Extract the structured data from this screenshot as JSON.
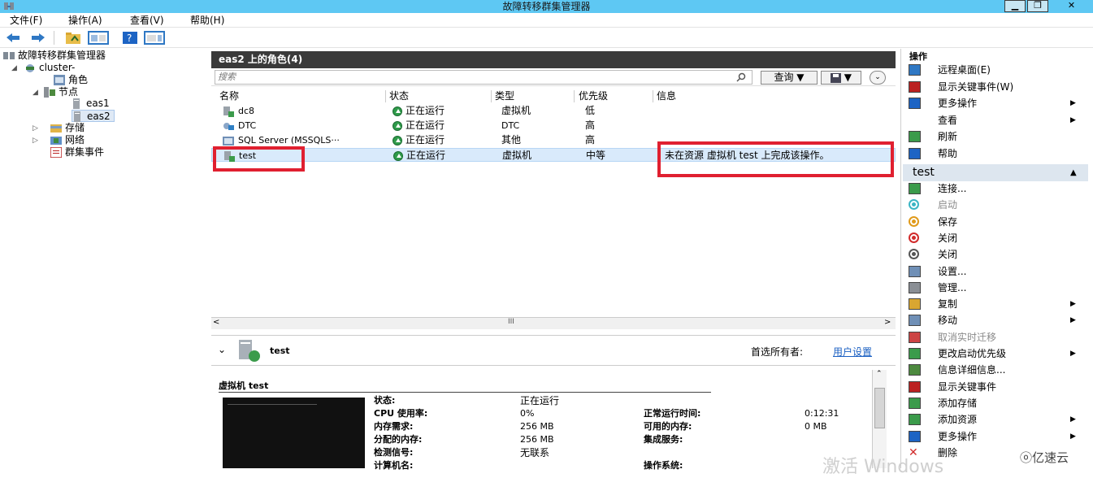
{
  "window": {
    "title": "故障转移群集管理器",
    "controls": {
      "minimize": "▁",
      "maximize": "❐",
      "close": "✕"
    }
  },
  "menu": [
    "文件(F)",
    "操作(A)",
    "查看(V)",
    "帮助(H)"
  ],
  "tree": {
    "root": "故障转移群集管理器",
    "cluster": "cluster-",
    "roles": "角色",
    "nodes": "节点",
    "node1": "eas1",
    "node2": "eas2",
    "storage": "存储",
    "network": "网络",
    "events": "群集事件"
  },
  "center": {
    "header": "eas2 上的角色(4)",
    "search_placeholder": "搜索",
    "query_label": "查询",
    "columns": [
      "名称",
      "状态",
      "类型",
      "优先级",
      "信息"
    ],
    "rows": [
      {
        "name": "dc8",
        "status": "正在运行",
        "type": "虚拟机",
        "priority": "低",
        "info": ""
      },
      {
        "name": "DTC",
        "status": "正在运行",
        "type": "DTC",
        "priority": "高",
        "info": ""
      },
      {
        "name": "SQL Server (MSSQLS···",
        "status": "正在运行",
        "type": "其他",
        "priority": "高",
        "info": ""
      },
      {
        "name": "test",
        "status": "正在运行",
        "type": "虚拟机",
        "priority": "中等",
        "info": "未在资源 虚拟机 test 上完成该操作。"
      }
    ],
    "scroll_mid": "III",
    "detail": {
      "name": "test",
      "preferred_owner_label": "首选所有者:",
      "preferred_owner_link": "用户设置",
      "section_title": "虚拟机 test",
      "left_labels": [
        "状态:",
        "CPU 使用率:",
        "内存需求:",
        "分配的内存:",
        "检测信号:",
        "计算机名:"
      ],
      "left_values": [
        "正在运行",
        "0%",
        "256 MB",
        "256 MB",
        "无联系",
        ""
      ],
      "right_labels": [
        "正常运行时间:",
        "可用的内存:",
        "集成服务:",
        "",
        "操作系统:"
      ],
      "right_values": [
        "0:12:31",
        "0 MB",
        "",
        "",
        ""
      ]
    }
  },
  "actions": {
    "header": "操作",
    "top": [
      {
        "label": "远程桌面(E)",
        "icon": "remote-desktop-icon"
      },
      {
        "label": "显示关键事件(W)",
        "icon": "events-icon"
      },
      {
        "label": "更多操作",
        "icon": "more-actions-icon",
        "more": "▶"
      },
      {
        "label": "查看",
        "icon": "",
        "more": "▶"
      },
      {
        "label": "刷新",
        "icon": "refresh-icon"
      },
      {
        "label": "帮助",
        "icon": "help-icon"
      }
    ],
    "test_header": "test",
    "test_collapse": "▲",
    "test_items": [
      {
        "label": "连接...",
        "icon": "connect-icon"
      },
      {
        "label": "启动",
        "icon": "start-icon",
        "disabled": true
      },
      {
        "label": "保存",
        "icon": "save-icon"
      },
      {
        "label": "关闭",
        "icon": "turn-off-icon"
      },
      {
        "label": "关闭",
        "icon": "shutdown-icon"
      },
      {
        "label": "设置...",
        "icon": "settings-icon"
      },
      {
        "label": "管理...",
        "icon": "manage-icon"
      },
      {
        "label": "复制",
        "icon": "replicate-icon",
        "more": "▶"
      },
      {
        "label": "移动",
        "icon": "move-icon",
        "more": "▶"
      },
      {
        "label": "取消实时迁移",
        "icon": "cancel-migration-icon",
        "disabled": true
      },
      {
        "label": "更改启动优先级",
        "icon": "priority-icon",
        "more": "▶"
      },
      {
        "label": "信息详细信息...",
        "icon": "info-icon"
      },
      {
        "label": "显示关键事件",
        "icon": "events-icon"
      },
      {
        "label": "添加存储",
        "icon": "add-storage-icon"
      },
      {
        "label": "添加资源",
        "icon": "add-resource-icon",
        "more": "▶"
      },
      {
        "label": "更多操作",
        "icon": "more-actions-icon",
        "more": "▶"
      },
      {
        "label": "删除",
        "icon": "delete-icon"
      }
    ]
  },
  "watermarks": {
    "activate": "激活 Windows",
    "brand": "亿速云"
  },
  "colors": {
    "titlebar": "#5ec8f3",
    "header": "#3a3a3a",
    "highlight": "#e02030",
    "running": "#2f9b4a",
    "link": "#1a5fc2"
  }
}
